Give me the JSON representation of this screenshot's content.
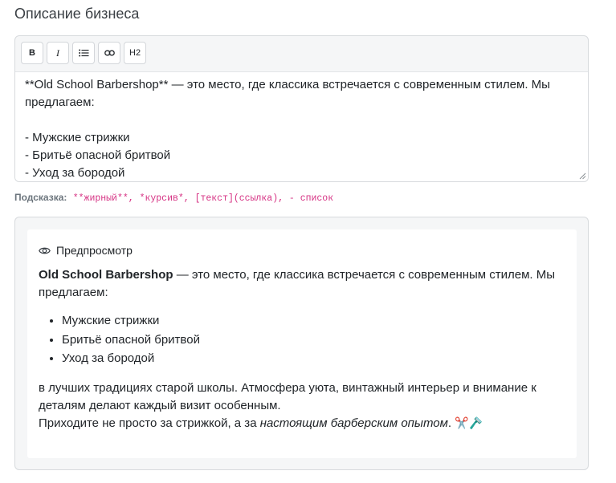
{
  "section": {
    "title": "Описание бизнеса"
  },
  "toolbar": {
    "bold": "B",
    "italic": "I",
    "h2": "H2"
  },
  "editor": {
    "text": "**Old School Barbershop** — это место, где классика встречается с современным стилем. Мы предлагаем:\n\n- Мужские стрижки\n- Бритьё опасной бритвой\n- Уход за бородой"
  },
  "hint": {
    "label": "Подсказка:",
    "syntax": "**жирный**, *курсив*, [текст](ссылка), - список"
  },
  "preview": {
    "title": "Предпросмотр",
    "intro_bold": "Old School Barbershop",
    "intro_rest": " — это место, где классика встречается с современным стилем. Мы предлагаем:",
    "list": [
      "Мужские стрижки",
      "Бритьё опасной бритвой",
      "Уход за бородой"
    ],
    "para2": "в лучших традициях старой школы. Атмосфера уюта, винтажный интерьер и внимание к деталям делают каждый визит особенным.",
    "para3_start": "Приходите не просто за стрижкой, а за ",
    "para3_em": "настоящим барберским опытом",
    "para3_end": ". ",
    "emojis": "✂️🪒"
  },
  "icons": {
    "list": "list-icon",
    "link": "link-icon",
    "preview": "eye-icon"
  }
}
